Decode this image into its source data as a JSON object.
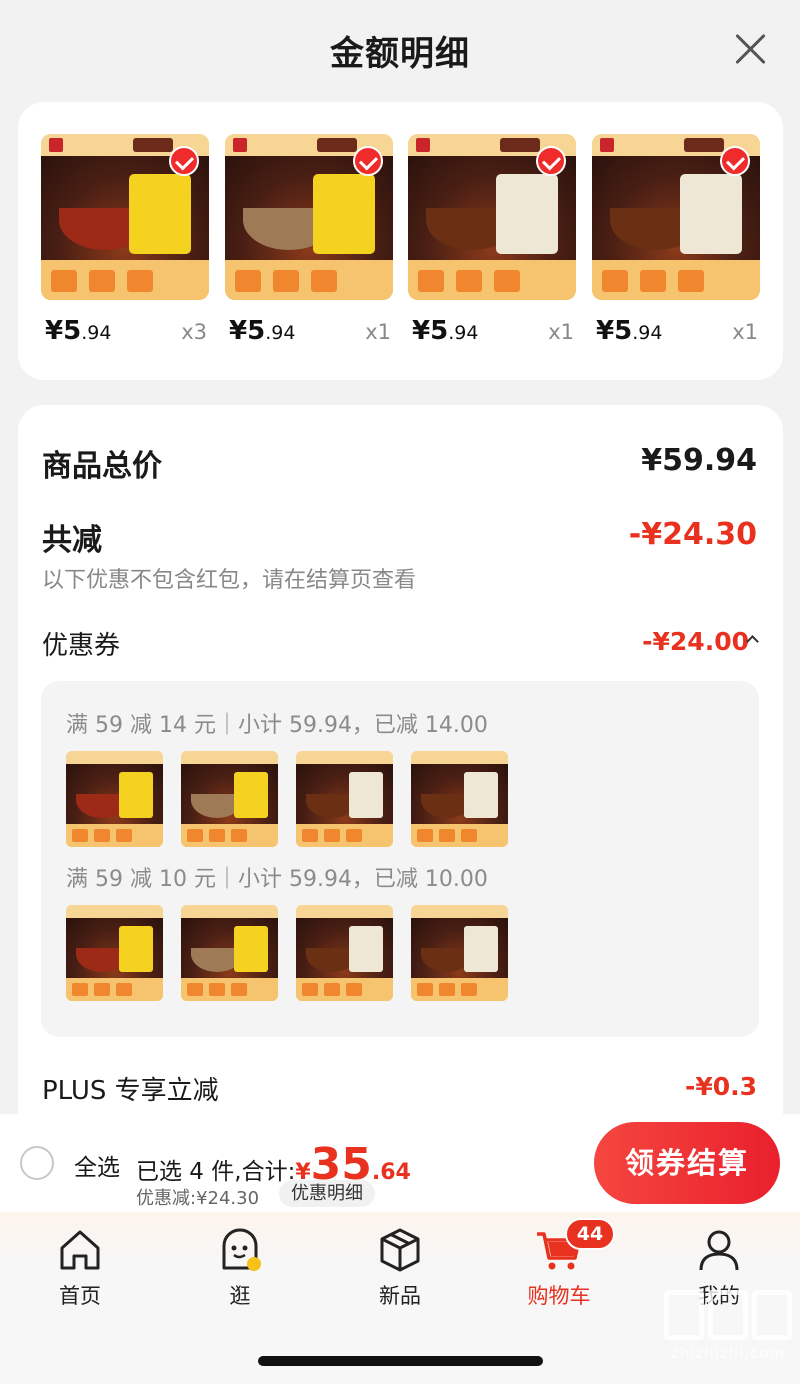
{
  "header": {
    "title": "金额明细",
    "close_icon": "close-icon"
  },
  "products": [
    {
      "price_int": "¥5",
      "price_dec": ".94",
      "qty": "x3",
      "bag": "yellow",
      "bowl_color": "#9c2a17"
    },
    {
      "price_int": "¥5",
      "price_dec": ".94",
      "qty": "x1",
      "bag": "yellow",
      "bowl_color": "#9e7a57"
    },
    {
      "price_int": "¥5",
      "price_dec": ".94",
      "qty": "x1",
      "bag": "white",
      "bowl_color": "#6b2f14"
    },
    {
      "price_int": "¥5",
      "price_dec": ".94",
      "qty": "x1",
      "bag": "white",
      "bowl_color": "#6b2f14"
    }
  ],
  "summary": {
    "total_label": "商品总价",
    "total_value": "¥59.94",
    "reduce_label": "共减",
    "reduce_value": "-¥24.30",
    "reduce_note": "以下优惠不包含红包，请在结算页查看",
    "coupon_label": "优惠券",
    "coupon_value": "-¥24.00",
    "coupon_groups": [
      {
        "text": "满 59 减 14 元｜小计 59.94，已减 14.00"
      },
      {
        "text": "满 59 减 10 元｜小计 59.94，已减 10.00"
      }
    ],
    "plus_label": "PLUS 专享立减",
    "plus_value": "-¥0.3"
  },
  "checkout": {
    "select_all": "全选",
    "selected_text": "已选 4 件,合计:",
    "total_symbol": "¥",
    "total_int": "35",
    "total_dec": ".64",
    "discount_text": "优惠减:¥24.30",
    "detail_chip": "优惠明细",
    "button": "领券结算"
  },
  "tabs": [
    {
      "label": "首页",
      "icon": "home-icon"
    },
    {
      "label": "逛",
      "icon": "mascot-icon"
    },
    {
      "label": "新品",
      "icon": "box-icon"
    },
    {
      "label": "购物车",
      "icon": "cart-icon",
      "badge": "44",
      "active": true
    },
    {
      "label": "我的",
      "icon": "user-icon"
    }
  ],
  "watermark": {
    "text": "zhizhizhi.com"
  },
  "colors": {
    "accent": "#e8321f",
    "button_gradient_start": "#f5463f",
    "button_gradient_end": "#e9202d"
  }
}
